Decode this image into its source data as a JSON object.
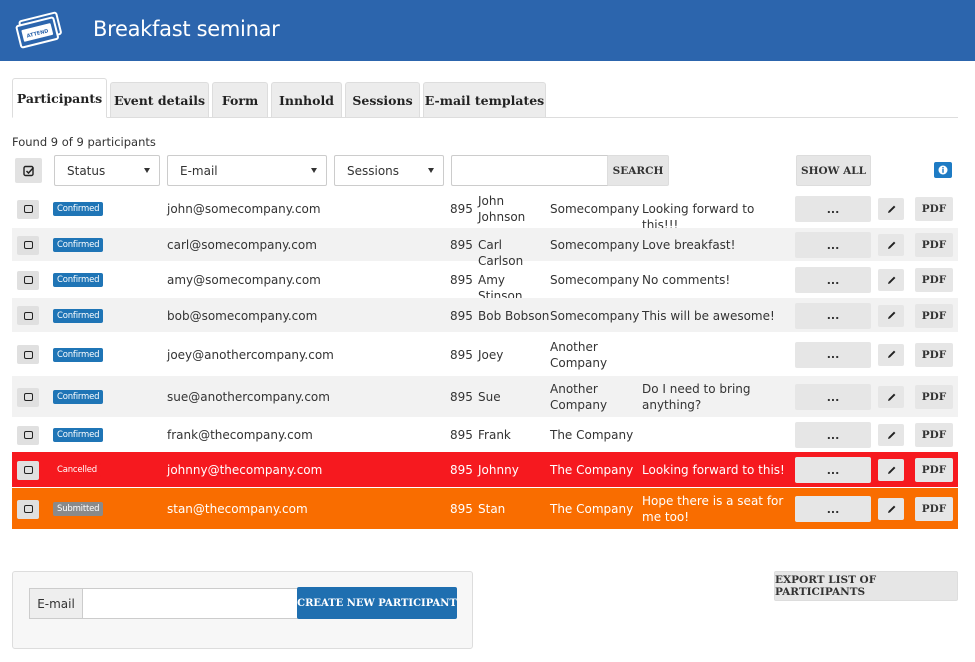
{
  "header": {
    "title": "Breakfast seminar",
    "logo_text": "ATTEND"
  },
  "tabs": [
    {
      "label": "Participants",
      "active": true
    },
    {
      "label": "Event details",
      "active": false
    },
    {
      "label": "Form",
      "active": false
    },
    {
      "label": "Innhold",
      "active": false
    },
    {
      "label": "Sessions",
      "active": false
    },
    {
      "label": "E-mail templates",
      "active": false
    }
  ],
  "found_text": "Found 9 of 9 participants",
  "filters": {
    "status": "Status",
    "email": "E-mail",
    "sessions": "Sessions",
    "search_value": "",
    "search_label": "SEARCH",
    "show_all_label": "SHOW ALL"
  },
  "participants": [
    {
      "status": "Confirmed",
      "email": "john@somecompany.com",
      "num": "895",
      "name": "John Johnson",
      "company": "Somecompany",
      "comment": "Looking forward to this!!!"
    },
    {
      "status": "Confirmed",
      "email": "carl@somecompany.com",
      "num": "895",
      "name": "Carl Carlson",
      "company": "Somecompany",
      "comment": "Love breakfast!"
    },
    {
      "status": "Confirmed",
      "email": "amy@somecompany.com",
      "num": "895",
      "name": "Amy Stinson",
      "company": "Somecompany",
      "comment": "No comments!"
    },
    {
      "status": "Confirmed",
      "email": "bob@somecompany.com",
      "num": "895",
      "name": "Bob Bobson",
      "company": "Somecompany",
      "comment": "This will be awesome!"
    },
    {
      "status": "Confirmed",
      "email": "joey@anothercompany.com",
      "num": "895",
      "name": "Joey",
      "company": "Another Company",
      "comment": ""
    },
    {
      "status": "Confirmed",
      "email": "sue@anothercompany.com",
      "num": "895",
      "name": "Sue",
      "company": "Another Company",
      "comment": "Do I need to bring anything?"
    },
    {
      "status": "Confirmed",
      "email": "frank@thecompany.com",
      "num": "895",
      "name": "Frank",
      "company": "The Company",
      "comment": ""
    },
    {
      "status": "Cancelled",
      "email": "johnny@thecompany.com",
      "num": "895",
      "name": "Johnny",
      "company": "The Company",
      "comment": "Looking forward to this!"
    },
    {
      "status": "Submitted",
      "email": "stan@thecompany.com",
      "num": "895",
      "name": "Stan",
      "company": "The Company",
      "comment": "Hope there is a seat for me too!"
    }
  ],
  "row_actions": {
    "more_label": "...",
    "pdf_label": "PDF"
  },
  "create": {
    "email_label": "E-mail",
    "email_value": "",
    "button_label": "CREATE NEW PARTICIPANT"
  },
  "export_label": "EXPORT LIST OF PARTICIPANTS",
  "colors": {
    "header": "#2c65ad",
    "confirmed": "#1f75b6",
    "cancelled": "#f6191f",
    "submitted": "#f96d00"
  }
}
